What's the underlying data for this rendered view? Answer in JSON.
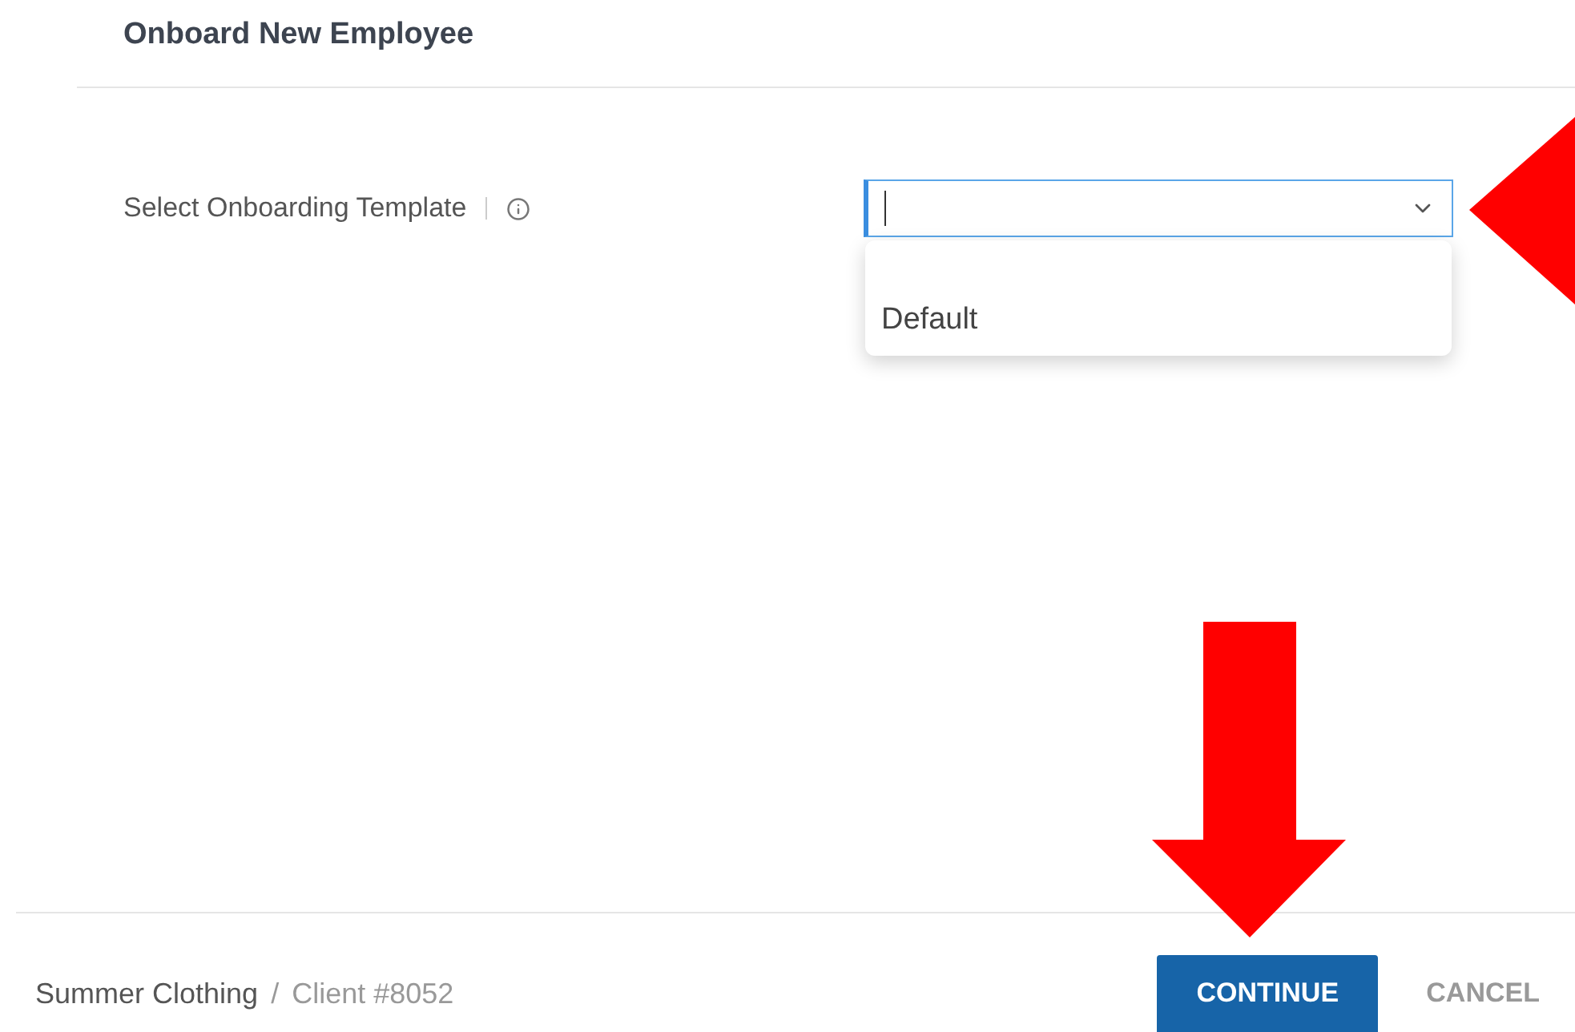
{
  "header": {
    "title": "Onboard New Employee"
  },
  "form": {
    "label": "Select Onboarding Template",
    "dropdown": {
      "expanded": true,
      "options": [
        {
          "kind": "blank",
          "selected": false
        },
        {
          "kind": "item",
          "label": "Default",
          "selected": false
        }
      ]
    }
  },
  "footer": {
    "client_name": "Summer Clothing",
    "separator": "/",
    "client_number": "Client #8052",
    "buttons": [
      {
        "label": "CONTINUE",
        "kind": "primary"
      },
      {
        "label": "CANCEL",
        "kind": "secondary"
      }
    ]
  }
}
